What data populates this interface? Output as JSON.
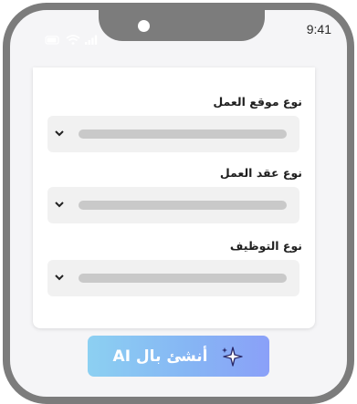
{
  "status_bar": {
    "time": "9:41",
    "icons": [
      "signal-icon",
      "wifi-icon",
      "battery-icon"
    ]
  },
  "form": {
    "fields": [
      {
        "label": "نوع موقع العمل"
      },
      {
        "label": "نوع عقد العمل"
      },
      {
        "label": "نوع التوظيف"
      }
    ]
  },
  "action": {
    "label": "أنشئ بال AI",
    "icon": "sparkle-icon"
  },
  "colors": {
    "frame": "#7c7c7c",
    "button_gradient_start": "#8cd0f2",
    "button_gradient_end": "#8aa0f8"
  }
}
